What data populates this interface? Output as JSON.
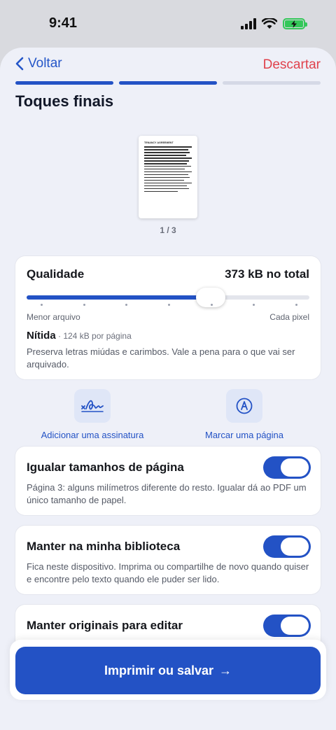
{
  "status": {
    "time": "9:41"
  },
  "nav": {
    "back_label": "Voltar",
    "discard_label": "Descartar"
  },
  "progress": {
    "steps_done": 2,
    "steps_total": 3
  },
  "page": {
    "title": "Toques finais"
  },
  "preview": {
    "heading": "TENANCY AGREEMENT",
    "counter": "1 / 3"
  },
  "quality": {
    "title": "Qualidade",
    "total": "373 kB no total",
    "slider_value_fraction": 0.65,
    "tick_count": 7,
    "min_label": "Menor arquivo",
    "max_label": "Cada pixel",
    "level_name": "Nítida",
    "level_detail": " · 124 kB por página",
    "description": "Preserva letras miúdas e carimbos. Vale a pena para o que vai ser arquivado."
  },
  "actions": {
    "sign_label": "Adicionar uma assinatura",
    "mark_label": "Marcar uma página"
  },
  "toggles": [
    {
      "title": "Igualar tamanhos de página",
      "description": "Página 3: alguns milímetros diferente do resto. Igualar dá ao PDF um único tamanho de papel.",
      "on": true
    },
    {
      "title": "Manter na minha biblioteca",
      "description": "Fica neste dispositivo. Imprima ou compartilhe de novo quando quiser e encontre pelo texto quando ele puder ser lido.",
      "on": true
    },
    {
      "title": "Manter originais para editar",
      "description": "",
      "on": true
    }
  ],
  "primary": {
    "label": "Imprimir ou salvar",
    "arrow": "→"
  },
  "colors": {
    "accent": "#2352c5",
    "danger": "#e0424c",
    "background": "#eef0f8",
    "battery": "#34c759"
  }
}
